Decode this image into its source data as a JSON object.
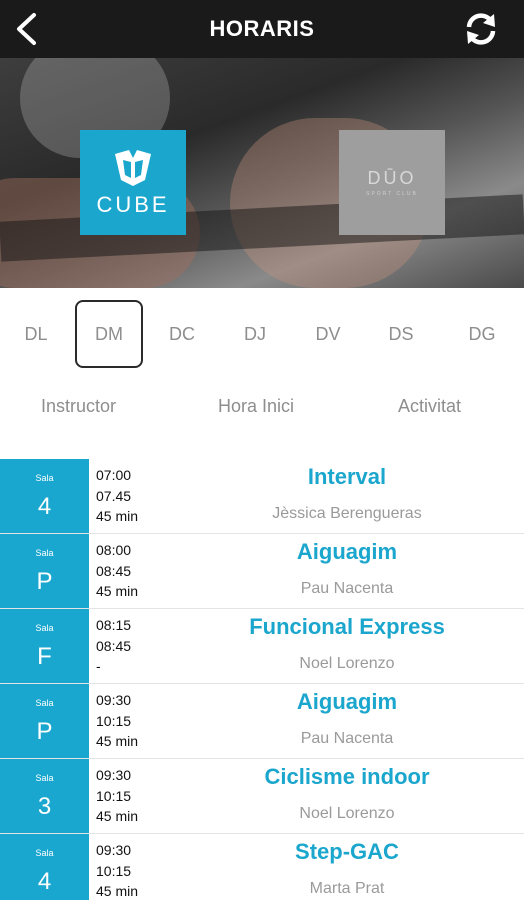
{
  "header": {
    "title": "HORARIS",
    "back_icon": "chevron-left-icon",
    "refresh_icon": "refresh-icon"
  },
  "brands": {
    "cube": "CUBE",
    "duo": "DŪO",
    "duo_sub": "SPORT CLUB"
  },
  "days": [
    {
      "label": "DL",
      "selected": false
    },
    {
      "label": "DM",
      "selected": true
    },
    {
      "label": "DC",
      "selected": false
    },
    {
      "label": "DJ",
      "selected": false
    },
    {
      "label": "DV",
      "selected": false
    },
    {
      "label": "DS",
      "selected": false
    },
    {
      "label": "DG",
      "selected": false
    }
  ],
  "sort": {
    "instructor": "Instructor",
    "start": "Hora Inici",
    "activity": "Activitat"
  },
  "colors": {
    "accent": "#1ba6cd",
    "topbar": "#1a1a1a",
    "muted": "#8e8e8e"
  },
  "classes": [
    {
      "sala_label": "Sala",
      "sala": "4",
      "start": "07:00",
      "end": "07.45",
      "duration": "45 min",
      "activity": "Interval",
      "instructor": "Jèssica Berengueras"
    },
    {
      "sala_label": "Sala",
      "sala": "P",
      "start": "08:00",
      "end": "08:45",
      "duration": "45 min",
      "activity": "Aiguagim",
      "instructor": "Pau Nacenta"
    },
    {
      "sala_label": "Sala",
      "sala": "F",
      "start": "08:15",
      "end": "08:45",
      "duration": "-",
      "activity": "Funcional Express",
      "instructor": "Noel Lorenzo"
    },
    {
      "sala_label": "Sala",
      "sala": "P",
      "start": "09:30",
      "end": "10:15",
      "duration": "45 min",
      "activity": "Aiguagim",
      "instructor": "Pau Nacenta"
    },
    {
      "sala_label": "Sala",
      "sala": "3",
      "start": "09:30",
      "end": "10:15",
      "duration": "45 min",
      "activity": "Ciclisme indoor",
      "instructor": "Noel Lorenzo"
    },
    {
      "sala_label": "Sala",
      "sala": "4",
      "start": "09:30",
      "end": "10:15",
      "duration": "45 min",
      "activity": "Step-GAC",
      "instructor": "Marta Prat"
    }
  ]
}
